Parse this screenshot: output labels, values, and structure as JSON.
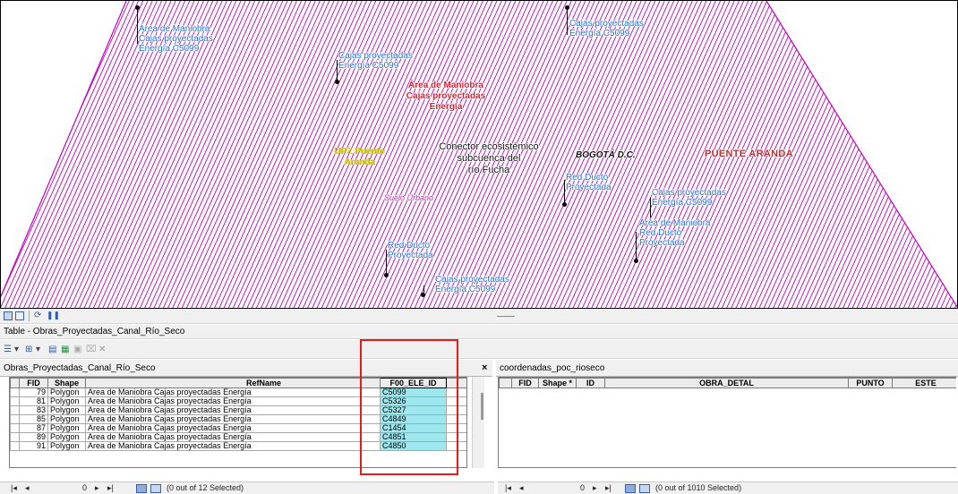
{
  "map": {
    "labels": {
      "l1": "Área de Maniobra",
      "l2": "Cajas proyectadas",
      "l3": "Energía C5099",
      "l4": "Cajas proyectadas",
      "l5": "Energía C5099",
      "l6": "Cajas proyectadas",
      "l7": "Energía C5099",
      "red1": "Área de Maniobra",
      "red2": "Cajas proyectadas",
      "red3": "Energía",
      "upz1": "UPZ Puente",
      "upz2": "Aranda",
      "con1": "Conector ecosistémico",
      "con2": "subcuenca del",
      "con3": "río Fucha",
      "bogota": "BOGOTÁ D.C.",
      "puente": "PUENTE ARANDA",
      "suelo": "Suelo Urbano",
      "rd1a": "Red Ducto",
      "rd1b": "Proyectada",
      "cp3a": "Cajas proyectadas",
      "cp3b": "Energía C5099",
      "am2a": "Área de Maniobra",
      "am2b": "Red Ducto",
      "am2c": "Proyectada",
      "rd2a": "Red Ducto",
      "rd2b": "Proyectada",
      "cp4a": "Cajas proyectadas",
      "cp4b": "Energía C5099"
    }
  },
  "table_window": {
    "title": "Table - Obras_Proyectadas_Canal_Río_Seco",
    "close_symbol": "×"
  },
  "left_table": {
    "tab_name": "Obras_Proyectadas_Canal_Río_Seco",
    "columns": [
      "FID",
      "Shape",
      "RefName",
      "F00_ELE_ID"
    ],
    "rows": [
      {
        "fid": "79",
        "shape": "Polygon",
        "refname": "Área de Maniobra Cajas proyectadas Energía",
        "ele": "C5099"
      },
      {
        "fid": "81",
        "shape": "Polygon",
        "refname": "Área de Maniobra Cajas proyectadas Energía",
        "ele": "C5326"
      },
      {
        "fid": "83",
        "shape": "Polygon",
        "refname": "Área de Maniobra Cajas proyectadas Energía",
        "ele": "C5327"
      },
      {
        "fid": "85",
        "shape": "Polygon",
        "refname": "Área de Maniobra Cajas proyectadas Energía",
        "ele": "C4849"
      },
      {
        "fid": "87",
        "shape": "Polygon",
        "refname": "Área de Maniobra Cajas proyectadas Energía",
        "ele": "C1454"
      },
      {
        "fid": "89",
        "shape": "Polygon",
        "refname": "Área de Maniobra Cajas proyectadas Energía",
        "ele": "C4851"
      },
      {
        "fid": "91",
        "shape": "Polygon",
        "refname": "Área de Maniobra Cajas proyectadas Energía",
        "ele": "C4850"
      }
    ],
    "record_position": "0",
    "status": "(0 out of 12 Selected)"
  },
  "right_table": {
    "tab_name": "coordenadas_poc_rioseco",
    "columns": [
      "FID",
      "Shape *",
      "ID",
      "OBRA_DETAL",
      "PUNTO",
      "ESTE"
    ],
    "record_position": "0",
    "status": "(0 out of 1010 Selected)"
  },
  "colors": {
    "hatch": "#c000c0",
    "label_blue": "#1f73d6",
    "label_red": "#e8192c",
    "selected_column": "#9ee7ef",
    "highlight_box": "#e31b1b"
  }
}
